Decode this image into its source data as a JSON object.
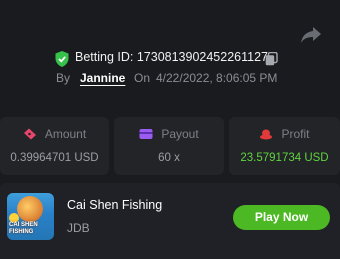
{
  "bet": {
    "id_label": "Betting ID: 1730813902452261127",
    "by_label": "By",
    "user": "Jannine",
    "on_label": "On",
    "date": "4/22/2022, 8:06:05 PM"
  },
  "stats": [
    {
      "label": "Amount",
      "value": "0.39964701 USD",
      "icon": "ticket-icon",
      "icon_color": "#e8456b"
    },
    {
      "label": "Payout",
      "value": "60 x",
      "icon": "card-icon",
      "icon_color": "#9b5cf2"
    },
    {
      "label": "Profit",
      "value": "23.5791734 USD",
      "icon": "coins-icon",
      "icon_color": "#e23a3a",
      "value_color": "#5fd43d"
    }
  ],
  "game": {
    "title": "Cai Shen Fishing",
    "provider": "JDB",
    "thumb_text": "CAI SHEN FISHING",
    "play_label": "Play Now"
  },
  "colors": {
    "background": "#1a1b1f",
    "card": "#232428",
    "accent_green": "#4cb823",
    "shield_green": "#36c24a"
  }
}
